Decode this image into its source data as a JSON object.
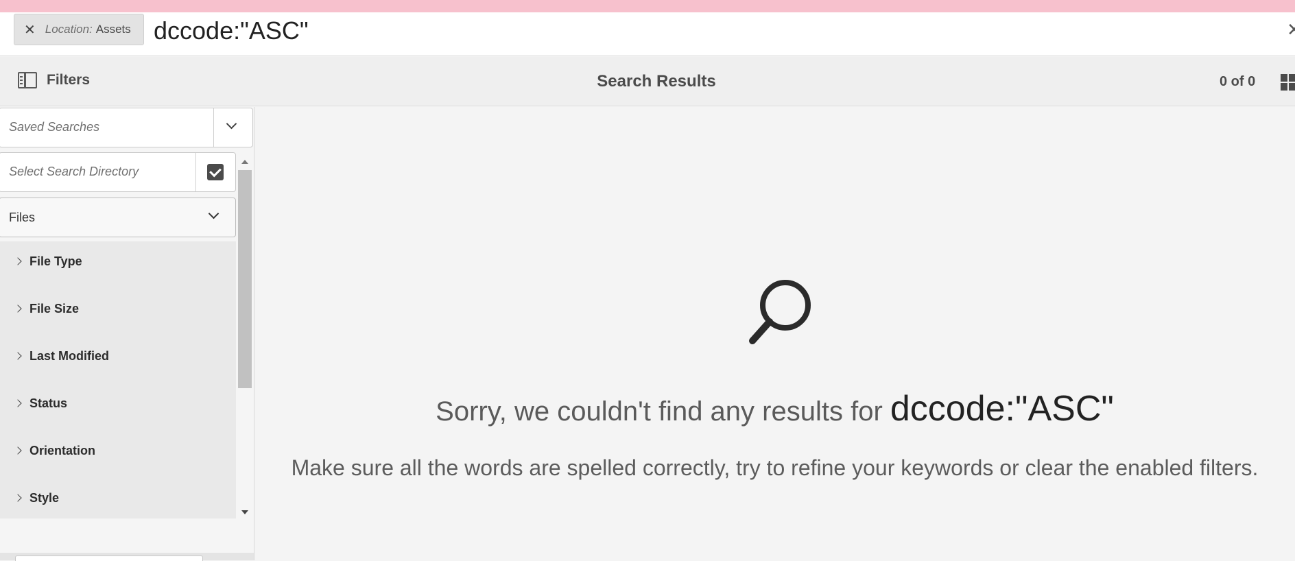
{
  "search": {
    "location_key": "Location:",
    "location_value": "Assets",
    "query": "dccode:\"ASC\""
  },
  "toolbar": {
    "filters_label": "Filters",
    "title": "Search Results",
    "count": "0 of 0"
  },
  "panel": {
    "saved_searches_placeholder": "Saved Searches",
    "directory_placeholder": "Select Search Directory",
    "scope_selected": "Files",
    "facets": [
      {
        "label": "File Type"
      },
      {
        "label": "File Size"
      },
      {
        "label": "Last Modified"
      },
      {
        "label": "Status"
      },
      {
        "label": "Orientation"
      },
      {
        "label": "Style"
      }
    ]
  },
  "empty_state": {
    "message_prefix": "Sorry, we couldn't find any results for ",
    "message_query": "dccode:\"ASC\"",
    "hint": "Make sure all the words are spelled correctly, try to refine your keywords or clear the enabled filters."
  },
  "icons": {
    "close": "close-icon",
    "filters": "filters-rail-icon",
    "grid": "grid-view-icon",
    "chevron": "chevron-down-icon",
    "check": "checkbox-icon",
    "search": "search-icon"
  },
  "colors": {
    "top_strip": "#f7c1cd",
    "background": "#f4f4f4",
    "facet_bg": "#e9e9e9",
    "text": "#2c2c2c"
  }
}
